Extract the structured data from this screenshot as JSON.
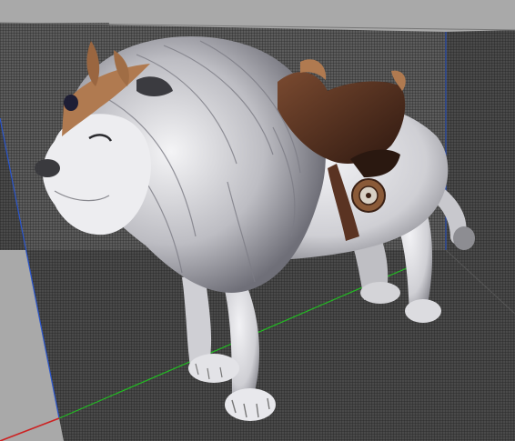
{
  "viewport": {
    "background_color": "#a9a9a9",
    "grid": true,
    "grid_line_color": "#2a2a2a",
    "floor_color": "#3a3a3a",
    "wall_color": "#4b4b4b",
    "axis_colors": {
      "x": "#cc2222",
      "y": "#22bb22",
      "z": "#2a55cc"
    }
  },
  "model": {
    "subject": "lion-mount-icon",
    "fur_color": "#e6e6ea",
    "mane_color": "#d9d9de",
    "saddle_color": "#5a3322",
    "armor_color": "#b07a50"
  }
}
